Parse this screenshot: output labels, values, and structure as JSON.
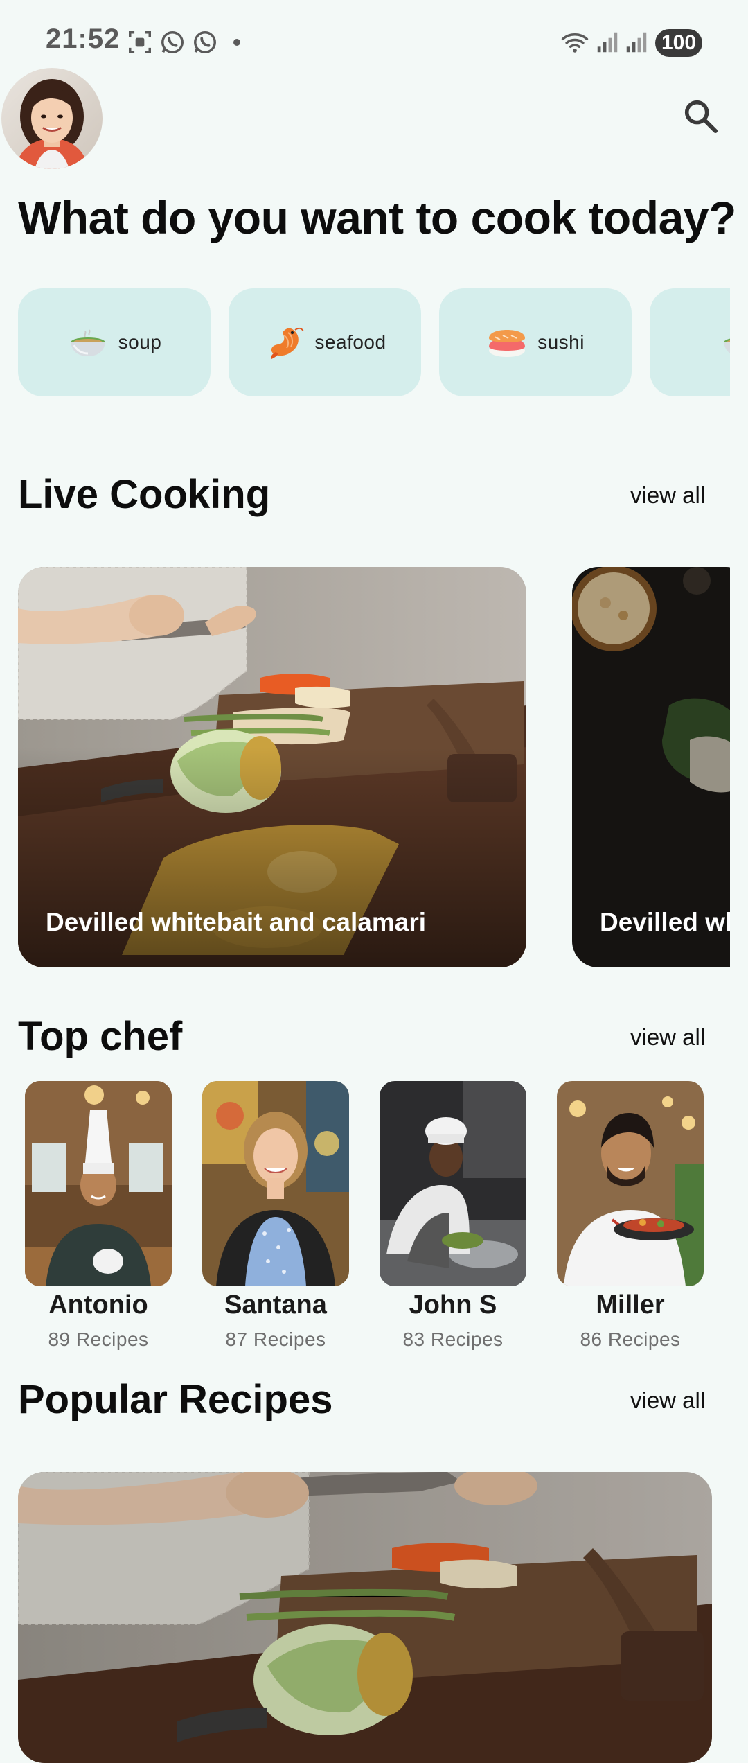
{
  "status_bar": {
    "time": "21:52",
    "icons": [
      "screenshot-icon",
      "whatsapp-icon",
      "whatsapp-icon",
      "dot-icon"
    ],
    "right_icons": [
      "wifi-icon",
      "signal-icon",
      "signal-icon"
    ],
    "battery": "100"
  },
  "header": {
    "avatar": "user-avatar",
    "search_icon": "search-icon"
  },
  "title": "What do you want to cook today?",
  "categories": [
    {
      "label": "soup",
      "icon": "soup-bowl-icon"
    },
    {
      "label": "seafood",
      "icon": "shrimp-icon"
    },
    {
      "label": "sushi",
      "icon": "sushi-icon"
    },
    {
      "label": "",
      "icon": "soup-bowl-icon"
    }
  ],
  "live_cooking": {
    "title": "Live Cooking",
    "view_all": "view all",
    "cards": [
      {
        "title": "Devilled whitebait and calamari"
      },
      {
        "title": "Devilled wh"
      }
    ]
  },
  "top_chef": {
    "title": "Top chef",
    "view_all": "view all",
    "chefs": [
      {
        "name": "Antonio",
        "recipes": "89 Recipes"
      },
      {
        "name": "Santana",
        "recipes": "87 Recipes"
      },
      {
        "name": "John S",
        "recipes": "83 Recipes"
      },
      {
        "name": "Miller",
        "recipes": "86 Recipes"
      }
    ]
  },
  "popular_recipes": {
    "title": "Popular Recipes",
    "view_all": "view all"
  },
  "colors": {
    "background": "#f3f9f7",
    "chip": "#d5eeec",
    "text": "#0d0d0d"
  }
}
